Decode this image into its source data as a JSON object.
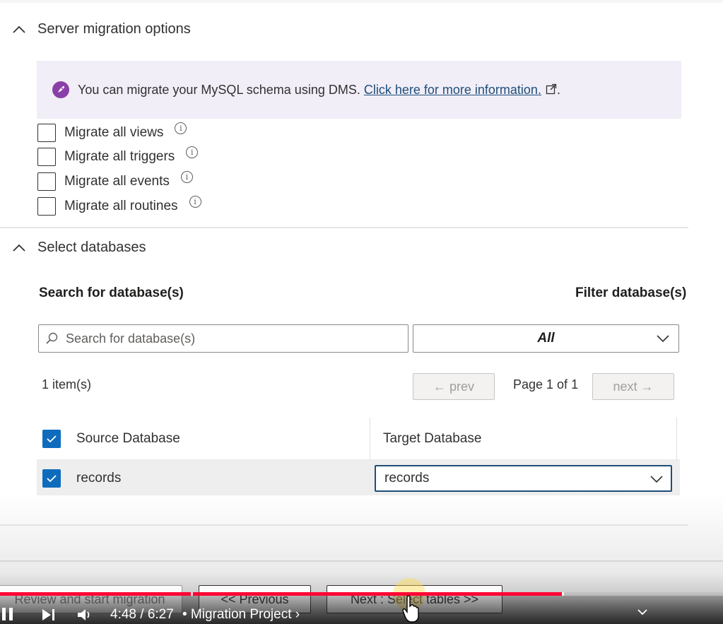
{
  "server_migration": {
    "title": "Server migration options",
    "banner": {
      "text": "You can migrate your MySQL schema using DMS.",
      "link": "Click here for more information.",
      "suffix": "."
    },
    "options": [
      {
        "label": "Migrate all views",
        "checked": false
      },
      {
        "label": "Migrate all triggers",
        "checked": false
      },
      {
        "label": "Migrate all events",
        "checked": false
      },
      {
        "label": "Migrate all routines",
        "checked": false
      }
    ]
  },
  "select_databases": {
    "title": "Select databases",
    "search_label": "Search for database(s)",
    "filter_label": "Filter database(s)",
    "search_placeholder": "Search for database(s)",
    "filter_value": "All",
    "item_count": "1 item(s)",
    "prev_label": "← prev",
    "page_text": "Page 1 of 1",
    "next_label": "next →",
    "columns": {
      "source": "Source Database",
      "target": "Target Database"
    },
    "rows": [
      {
        "source": "records",
        "target": "records",
        "checked": true
      }
    ]
  },
  "actions": {
    "review": "Review and start migration",
    "previous": "<< Previous",
    "next": "Next : Select tables >>"
  },
  "video": {
    "time": "4:48 / 6:27",
    "chapter": "• Migration Project ›",
    "progress_fraction": 0.777,
    "accent_color": "#ff0033"
  },
  "colors": {
    "checkbox_checked": "#0f6cbd",
    "banner_bg": "#f1eef8"
  }
}
